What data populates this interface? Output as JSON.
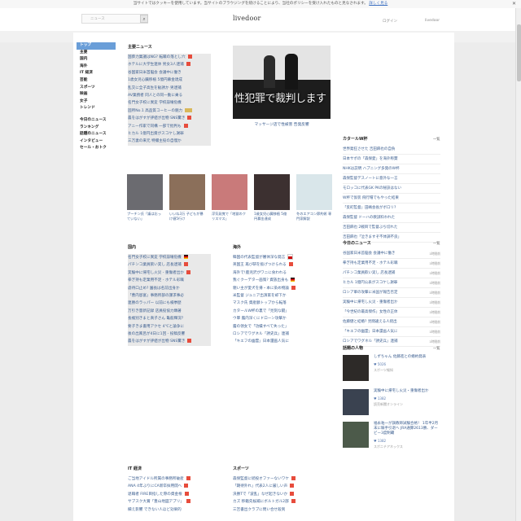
{
  "cookie": {
    "message": "当サイトではクッキーを使用しています。当サイトのブラウジングを続けることにより、当社のポリシーを受け入れたものと見なされます。",
    "link": "詳しく見る",
    "close": "✕"
  },
  "header": {
    "logo": "livedoor",
    "search_placeholder": "ニュース",
    "links": [
      "ログイン",
      "livedoor"
    ]
  },
  "nav": {
    "items": [
      "トップ",
      "主要",
      "国内",
      "海外",
      "IT 経済",
      "芸能",
      "スポーツ",
      "映画",
      "女子",
      "トレンド"
    ],
    "items2": [
      "今日のニュース",
      "ランキング",
      "話題のニュース",
      "インタビュー",
      "セール・おトク"
    ]
  },
  "main_news": {
    "title": "主要ニュース",
    "items": [
      {
        "text": "国葬力業議はNG? 転職の落とし穴",
        "tag": "new"
      },
      {
        "text": "ホテルに大学生連体 男女3人逮捕",
        "tag": "new"
      },
      {
        "text": "谷国家日米首脳会 会議中に働き",
        "tag": ""
      },
      {
        "text": "1歳女児心臓移植 5億円募金達成",
        "tag": ""
      },
      {
        "text": "乱交に全子高生を勧誘か 男逮捕",
        "tag": ""
      },
      {
        "text": "AV業務者 同人との同一動に乗る",
        "tag": ""
      },
      {
        "text": "名門女子校に異変 学校崩壊危機",
        "tag": ""
      },
      {
        "text": "固所No.1 高品質コーヒーの魅力",
        "tag": "video"
      },
      {
        "text": "農をはがすが評値が出物 SNS驚き",
        "tag": "new"
      },
      {
        "text": "アニー作家で同構 一部で批判も",
        "tag": "new"
      },
      {
        "text": "ヒカル 1億円出資がスコケし謝罪",
        "tag": ""
      },
      {
        "text": "三万妻の来元 特撮主役の自慢か",
        "tag": ""
      }
    ]
  },
  "feature": {
    "image_text": "性犯罪で裁判します",
    "caption": "マッサージ店で性被害 告発反響"
  },
  "thumbs": [
    {
      "caption": "プーチン氏「議は忘っていない」",
      "color": "#6b6b70"
    },
    {
      "caption": "いいね3万 子どもが暴け値5行け",
      "color": "#8b6f5a"
    },
    {
      "caption": "浮気発覚で「地獄のクリスマス」",
      "color": "#c97a7a"
    },
    {
      "caption": "1歳女児心臓移植 5億円募金達成",
      "color": "#3c3030"
    },
    {
      "caption": "冬のエアコン節約術 専門家解説",
      "color": "#d9e6ea"
    }
  ],
  "kokunai": {
    "title": "国内",
    "items": [
      {
        "text": "名門女子校に異変 学校崩壊危機",
        "tag": "flag"
      },
      {
        "text": "パチンコ業員飲い実し 店長逮捕",
        "tag": "new"
      },
      {
        "text": "実験中に帰宅し火災 - 重傷者出か",
        "tag": "new"
      },
      {
        "text": "拳ぎ持も定業用不足 - ホテル彩職",
        "tag": ""
      },
      {
        "text": "虐待口止め? 園長は名前出身か",
        "tag": ""
      },
      {
        "text": "「曹内恩富」事務所部の課求事必",
        "tag": ""
      },
      {
        "text": "連勝のラッパー 以前にも検挙歴",
        "tag": ""
      },
      {
        "text": "万引き量新記録 店員役協力顕著",
        "tag": ""
      },
      {
        "text": "長複別きまと真子さん 亀般輝況?",
        "tag": ""
      },
      {
        "text": "要子きま書用アクセ 4℃と論争に",
        "tag": ""
      },
      {
        "text": "後の出風呂が4日に1回 - 投稿反響",
        "tag": ""
      },
      {
        "text": "農をはがすが評値が出物 SNS驚き",
        "tag": "new"
      }
    ]
  },
  "kaigai": {
    "title": "海外",
    "items": [
      {
        "text": "韓国の代表監督が審体深な発言",
        "tag": "flag2"
      },
      {
        "text": "英国王 再び研を扱げつけられる",
        "tag": "new"
      },
      {
        "text": "海外で!鹿児沢がワニに食われる",
        "tag": ""
      },
      {
        "text": "我ぐクーデター画策? 資族出身も",
        "tag": "flag"
      },
      {
        "text": "親い主が愛犬を帰・本に染め物論",
        "tag": "new"
      },
      {
        "text": "米監督 ジュニア出演家を却下か",
        "tag": ""
      },
      {
        "text": "マスク氏 資産額トップから転落",
        "tag": ""
      },
      {
        "text": "カタールW杯の裏で「見刻な闘」",
        "tag": ""
      },
      {
        "text": "ウ軍 露内深くにドローン攻撃か",
        "tag": ""
      },
      {
        "text": "露の領女で「功績すべて失った」",
        "tag": ""
      },
      {
        "text": "ロシアでワグネル「誘史兵」連捕",
        "tag": ""
      },
      {
        "text": "「キエフの幽霊」日本還画人気に",
        "tag": ""
      }
    ]
  },
  "worldcup": {
    "title": "カタールW杯",
    "more": "一覧",
    "items": [
      "世界発狂させた 吉田麻也の自負",
      "日本サポの「森保愛」を海外称賛",
      "NHKは説明 ハプニング多発のW杯",
      "森保監督デスノートに意外な一言",
      "モロッコに代表GK PKの秘訣はない",
      "W杯で仮装 飛行帽でもやった結果",
      "「反町監督」田嶋会長がボロリ?",
      "森保監督 ドーハの教訓料われた",
      "吉田麻也 2戦目で監督ぶち切れた",
      "吉田麻也「泣きますぞ不体調不良」"
    ]
  },
  "today": {
    "title": "今日のニュース",
    "more": "一覧",
    "items": [
      {
        "text": "谷国家日米首脳会 会議中に働き",
        "time": "1時間前"
      },
      {
        "text": "拳ぎ持も定業用不足 - ホテル彩職",
        "time": "1時間前"
      },
      {
        "text": "パチンコ業員飲い実し 店長逮捕",
        "time": "1時間前"
      },
      {
        "text": "ヒカル 1億円公表がスコケし謝罪",
        "time": "1時間前"
      },
      {
        "text": "ロシア軍の攻撃に米国が報告否定",
        "time": "1時間前"
      },
      {
        "text": "実験中に帰宅し火災 - 重傷者出か",
        "time": "1時間前"
      },
      {
        "text": "「今世紀の最高傑作」女性の正体",
        "time": "1時間前"
      },
      {
        "text": "佐藤健と結婚? 見間違える人続出",
        "time": "1時間前"
      },
      {
        "text": "「キエフの幽霊」日本還画人気に",
        "time": "1時間前"
      },
      {
        "text": "ロシアでワグネル「誘史兵」連捕",
        "time": "1時間前"
      }
    ]
  },
  "buzz": {
    "title": "話題の人物",
    "more": "一覧",
    "items": [
      {
        "text": "しずちゃん 佐藤進との婚約発表",
        "count": "5026",
        "source": "スポーツ報知",
        "color": "#2d2a28"
      },
      {
        "text": "実験中に帰宅し火災・重傷者出か",
        "count": "1382",
        "source": "読売新聞オンライン",
        "color": "#3a4250"
      },
      {
        "text": "福永祐一が調教師試験合格！ 1年半2月末に騎手引退へ JRA通算2613勝、ダービー3度制覇",
        "count": "1382",
        "source": "スポニチアネックス",
        "color": "#4c5a4a"
      }
    ]
  },
  "it_keizai": {
    "title": "IT 経済",
    "items": [
      {
        "text": "ご当地アイドル所属の事務所破産",
        "tag": "new"
      },
      {
        "text": "ANA 4年ぶりにCA新卒採用開へ",
        "tag": "new"
      },
      {
        "text": "退職者 FIRE目指した際の資金根",
        "tag": "new"
      },
      {
        "text": "サブスク大賞「豊山地図アプリ」",
        "tag": "new"
      },
      {
        "text": "欄え影響 できない人ほど効果的",
        "tag": ""
      }
    ]
  },
  "sports": {
    "title": "スポーツ",
    "items": [
      {
        "text": "森保監督に続投オファーないワケ",
        "tag": "new"
      },
      {
        "text": "「期待外れ」代表2人に厳しい声",
        "tag": "new"
      },
      {
        "text": "決勝Tで「波乱」なぜ起きないか",
        "tag": "new"
      },
      {
        "text": "カズ 移籍先候補にボルトガル2部",
        "tag": "new"
      },
      {
        "text": "三笘書出クラブに問い合せ殺到",
        "tag": ""
      }
    ]
  }
}
